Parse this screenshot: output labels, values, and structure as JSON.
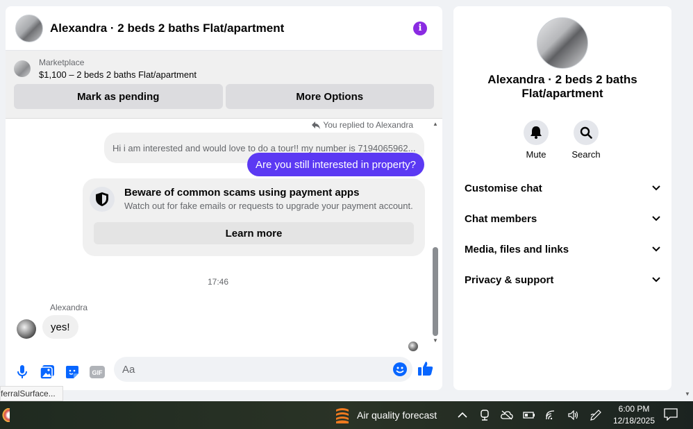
{
  "header": {
    "title": "Alexandra · 2 beds 2 baths Flat/apartment",
    "info_icon": "i"
  },
  "marketplace": {
    "label": "Marketplace",
    "listing": "$1,100 – 2 beds 2 baths Flat/apartment",
    "buttons": {
      "pending": "Mark as pending",
      "more": "More Options"
    }
  },
  "messages": {
    "replied_note": "You replied to Alexandra",
    "quoted_text": "Hi i am interested and would love to do a tour!! my number is 7194065962...",
    "outgoing_text": "Are you still interested in property?",
    "scam_card": {
      "title": "Beware of common scams using payment apps",
      "subtitle": "Watch out for fake emails or requests to upgrade your payment account.",
      "button": "Learn more"
    },
    "time_separator": "17:46",
    "sender_name": "Alexandra",
    "incoming_text": "yes!"
  },
  "composer": {
    "placeholder": "Aa",
    "gif_label": "GIF"
  },
  "right_panel": {
    "title": "Alexandra · 2 beds 2 baths Flat/apartment",
    "actions": {
      "mute": "Mute",
      "search": "Search"
    },
    "rows": [
      "Customise chat",
      "Chat members",
      "Media, files and links",
      "Privacy & support"
    ]
  },
  "tooltip": {
    "text": "ferralSurface..."
  },
  "taskbar": {
    "weather": "Air quality forecast",
    "time": "6:00 PM",
    "date": "12/18/2025"
  },
  "colors": {
    "accent": "#0866ff",
    "outgoing_bubble": "#5b39f3",
    "info_purple": "#8a2be2"
  }
}
